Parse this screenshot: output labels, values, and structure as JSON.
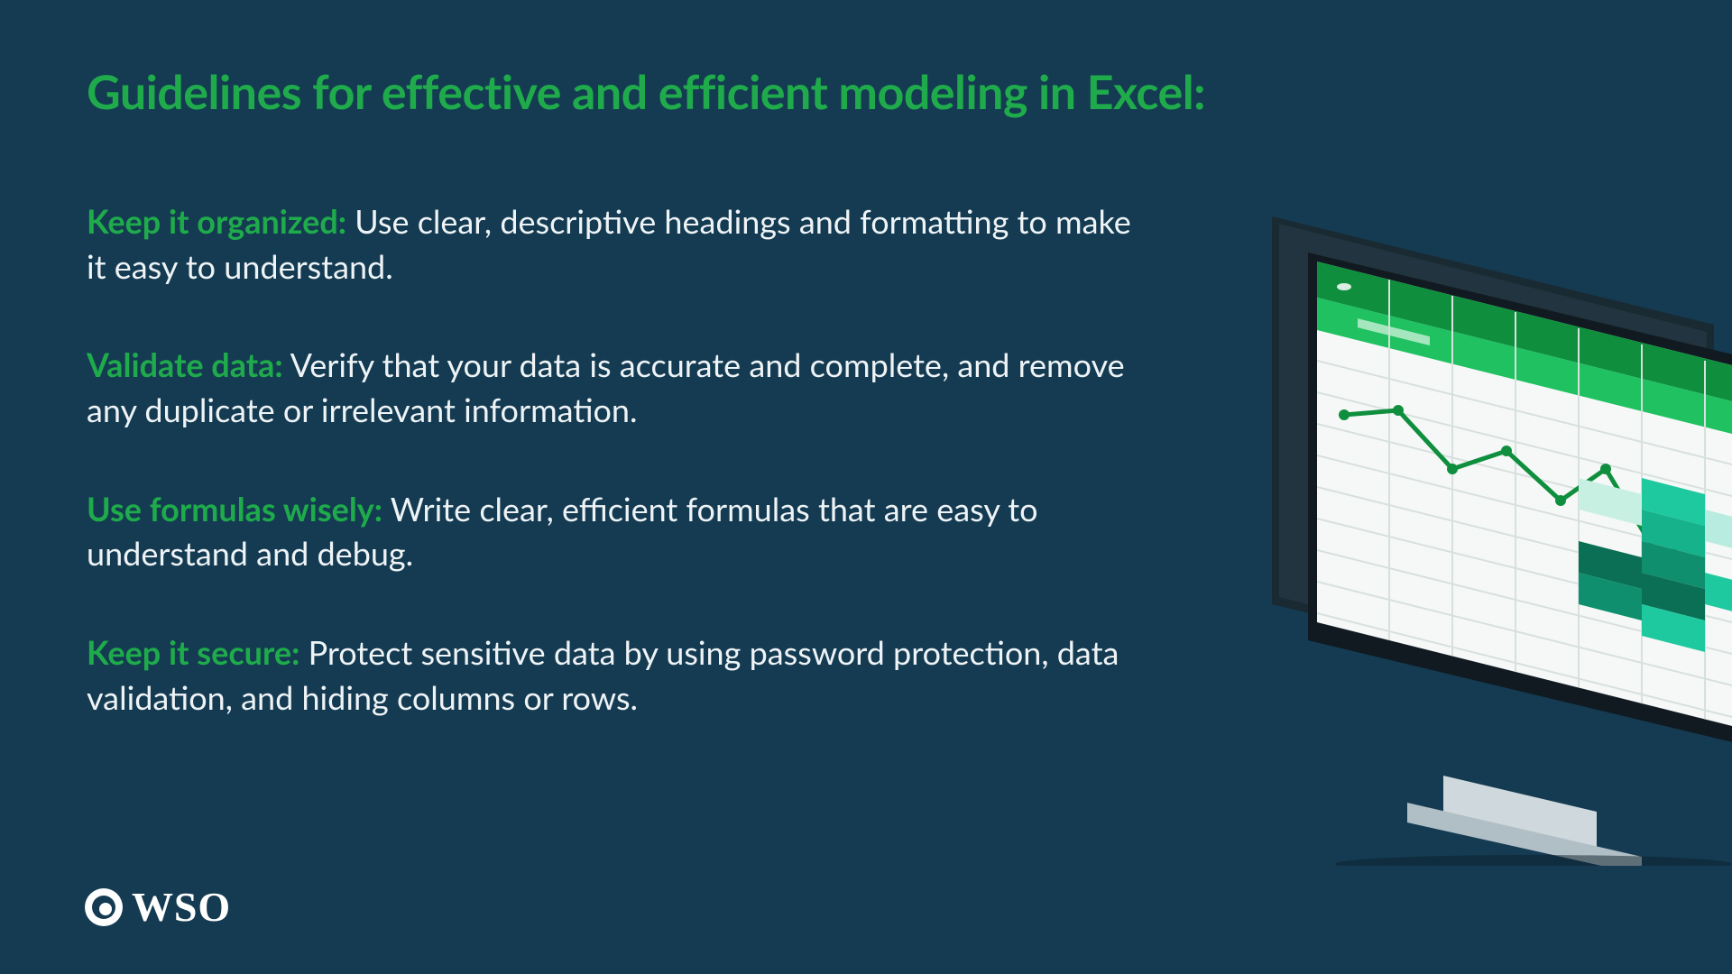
{
  "title": "Guidelines for effective and efficient modeling in Excel:",
  "items": [
    {
      "lead": "Keep it organized:",
      "body": " Use clear, descriptive headings and formatting to make it easy to understand."
    },
    {
      "lead": "Validate data:",
      "body": " Verify that your data is accurate and complete, and remove any duplicate or irrelevant information."
    },
    {
      "lead": "Use formulas wisely:",
      "body": " Write clear, efficient formulas that are easy to understand and debug."
    },
    {
      "lead": "Keep it secure:",
      "body": " Protect sensitive data by using password protection, data validation, and hiding columns or rows."
    }
  ],
  "logo": {
    "text": "WSO"
  },
  "colors": {
    "bg": "#143b52",
    "accent": "#1fab4b",
    "text": "#eef3f6"
  }
}
